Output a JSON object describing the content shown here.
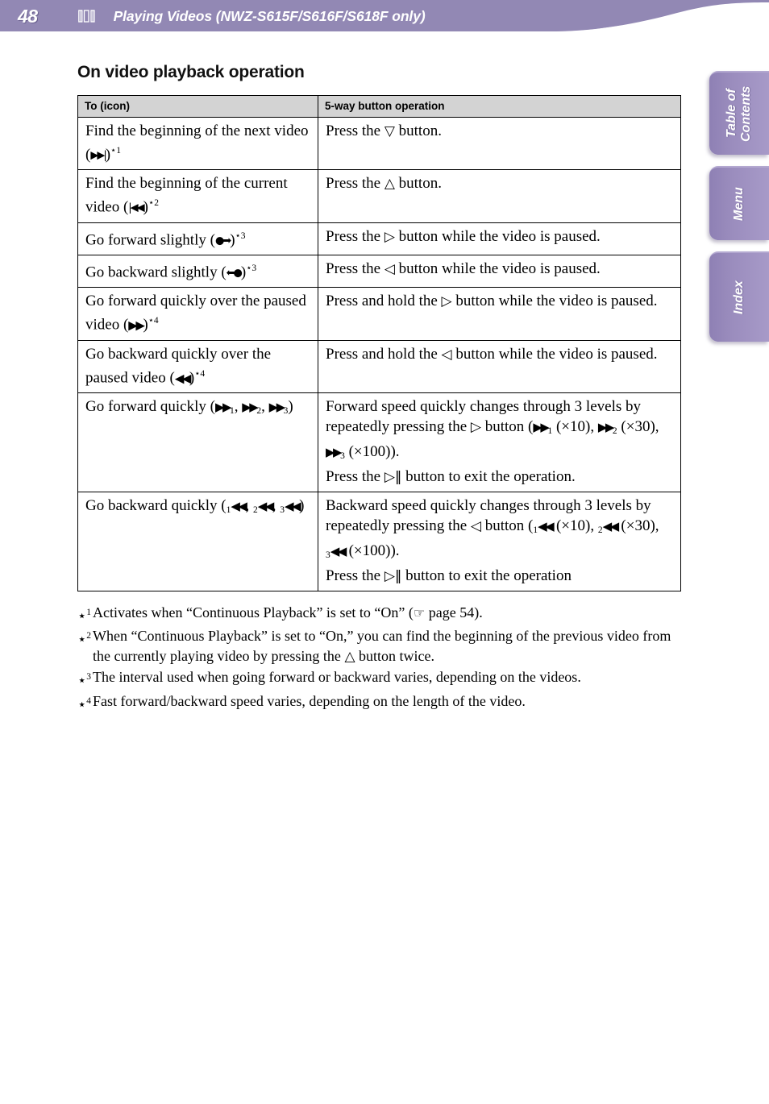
{
  "header": {
    "page_number": "48",
    "icon": "film-strip-icon",
    "title": "Playing Videos (NWZ-S615F/S616F/S618F only)",
    "bar_color": "#9288b4",
    "text_color": "#ffffff"
  },
  "side_tabs": [
    {
      "id": "table-of-contents",
      "label": "Table of\nContents"
    },
    {
      "id": "menu",
      "label": "Menu"
    },
    {
      "id": "index",
      "label": "Index"
    }
  ],
  "main": {
    "heading": "On video playback operation",
    "table": {
      "headers": [
        "To (icon)",
        "5-way button operation"
      ],
      "rows": [
        {
          "to_text_before": "Find the beginning of the next video (",
          "to_icon": "▶▶|",
          "to_text_after": ")",
          "to_footnote": "⋆1",
          "op_before": "Press the ",
          "op_glyph": "▽",
          "op_after": " button."
        },
        {
          "to_text_before": "Find the beginning of the current video (",
          "to_icon": "|◀◀",
          "to_text_after": ")",
          "to_footnote": "⋆2",
          "op_before": "Press the ",
          "op_glyph": "△",
          "op_after": " button."
        },
        {
          "to_text_before": "Go forward slightly (",
          "to_icon": "●➡",
          "to_text_after": ")",
          "to_footnote": "⋆3",
          "op_before": "Press the ",
          "op_glyph": "▷",
          "op_after": " button while the video is paused."
        },
        {
          "to_text_before": "Go backward slightly (",
          "to_icon": "⬅●",
          "to_text_after": ")",
          "to_footnote": "⋆3",
          "op_before": "Press the ",
          "op_glyph": "◁",
          "op_after": " button while the video is paused."
        },
        {
          "to_text_before": "Go forward quickly over the paused video (",
          "to_icon": "▶▶",
          "to_text_after": ")",
          "to_footnote": "⋆4",
          "op_before": "Press and hold the ",
          "op_glyph": "▷",
          "op_after": " button while the video is paused."
        },
        {
          "to_text_before": "Go backward quickly over the paused video (",
          "to_icon": "◀◀",
          "to_text_after": ")",
          "to_footnote": "⋆4",
          "op_before": "Press and hold the ",
          "op_glyph": "◁",
          "op_after": " button while the video is paused."
        }
      ],
      "row_forward_quickly": {
        "to_prefix": "Go forward quickly (",
        "to_icon": "▶▶",
        "to_subs": [
          "1",
          "2",
          "3"
        ],
        "to_suffix": ")",
        "op_line1_a": "Forward speed quickly changes through 3 levels by repeatedly pressing the ",
        "op_glyph": "▷",
        "op_line1_b": " button (",
        "speeds": [
          {
            "sub": "1",
            "value": "(×10),"
          },
          {
            "sub": "2",
            "value": "(×30),"
          },
          {
            "sub": "3",
            "value": "(×100))."
          }
        ],
        "op_line2_a": "Press the ",
        "op_line2_glyph": "▷‖",
        "op_line2_b": " button to exit the operation."
      },
      "row_backward_quickly": {
        "to_prefix": "Go backward quickly (",
        "to_icon": "◀◀",
        "to_subs": [
          "1",
          "2",
          "3"
        ],
        "to_suffix": ")",
        "op_line1_a": "Backward speed quickly changes through 3 levels by repeatedly pressing the ",
        "op_glyph": "◁",
        "op_line1_b": " button (",
        "speeds": [
          {
            "sub": "1",
            "value": "(×10),"
          },
          {
            "sub": "2",
            "value": "(×30),"
          },
          {
            "sub": "3",
            "value": "(×100))."
          }
        ],
        "op_line2_a": "Press the ",
        "op_line2_glyph": "▷‖",
        "op_line2_b": " button to exit the operation"
      }
    },
    "footnotes": [
      {
        "mark": "1",
        "text_a": "Activates when “Continuous Playback” is set to “On” (",
        "icon": "☞",
        "text_b": " page 54)."
      },
      {
        "mark": "2",
        "text_a": "When “Continuous Playback” is set to “On,” you can find the beginning of the previous video from the currently playing video by pressing the ",
        "icon": "△",
        "text_b": " button twice."
      },
      {
        "mark": "3",
        "text_a": "The interval used when going forward or backward varies, depending on the videos.",
        "icon": "",
        "text_b": ""
      },
      {
        "mark": "4",
        "text_a": "Fast forward/backward speed varies, depending on the length of the video.",
        "icon": "",
        "text_b": ""
      }
    ]
  }
}
